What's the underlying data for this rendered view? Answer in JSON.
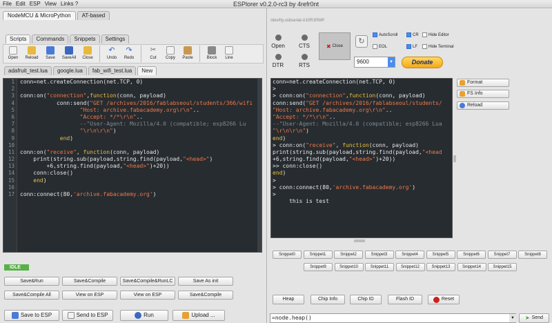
{
  "window": {
    "title": "ESPlorer v0.2.0-rc3 by 4refr0nt"
  },
  "menu": [
    "File",
    "Edit",
    "ESP",
    "View",
    "Links ?"
  ],
  "firmware_tabs": [
    "NodeMCU & MicroPython",
    "AT-based"
  ],
  "sub_tabs": [
    "Scripts",
    "Commands",
    "Snippets",
    "Settings"
  ],
  "toolbar": {
    "open": "Open",
    "reload": "Reload",
    "save": "Save",
    "saveall": "SaveAll",
    "close": "Close",
    "undo": "Undo",
    "redo": "Redo",
    "cut": "Cut",
    "copy": "Copy",
    "paste": "Paste",
    "block": "Block",
    "line": "Line"
  },
  "file_tabs": [
    "adafruit_test.lua",
    "google.lua",
    "fab_wifi_test.lua",
    "New"
  ],
  "editor": {
    "line_numbers": [
      "1",
      "2",
      "3",
      "4",
      "5",
      "6",
      "7",
      "8",
      "9",
      "10",
      "11",
      "12",
      "13",
      "14",
      "15",
      "16",
      "17"
    ]
  },
  "status": {
    "idle": "IDLE"
  },
  "left_buttons": {
    "save_run": "Save&Run",
    "save_compile": "Save&Compile",
    "save_compile_runlc": "Save&Compile&RunLC",
    "save_as_init": "Save As init",
    "save_compile_all": "Save&Compile All",
    "view_on_esp_1": "View on ESP",
    "view_on_esp_2": "View on ESP",
    "save_compile_2": "Save&Compile",
    "save_to_esp": "Save to ESP",
    "send_to_esp": "Send to ESP",
    "run": "Run",
    "upload": "Upload ..."
  },
  "connection": {
    "port": "/dev/tty.usbserial-A10R1RMP",
    "open": "Open",
    "cts": "CTS",
    "dtr": "DTR",
    "rts": "RTS",
    "close": "Close",
    "autoscroll": "AutoScroll",
    "eol": "EOL",
    "cr": "CR",
    "lf": "LF",
    "hide_editor": "Hide Editor",
    "hide_terminal": "Hide Terminal",
    "baud": "9600",
    "donate": "Donate"
  },
  "side_buttons": {
    "format": "Format",
    "fs_info": "FS Info",
    "reload": "Reload"
  },
  "snippets": [
    "Snippet0",
    "Snippet1",
    "Snippet2",
    "Snippet3",
    "Snippet4",
    "Snippet5",
    "Snippet6",
    "Snippet7",
    "Snippet8",
    "Snippet9",
    "Snippet10",
    "Snippet11",
    "Snippet12",
    "Snippet13",
    "Snippet14",
    "Snippet15"
  ],
  "bottom_buttons": {
    "heap": "Heap",
    "chip_info": "Chip Info",
    "chip_id": "Chip ID",
    "flash_id": "Flash ID",
    "reset": "Reset"
  },
  "command": {
    "value": "=node.heap()",
    "send": "Send"
  },
  "colors": {
    "editor_bg": "#272c30",
    "string": "#f07848",
    "keyword": "#e8c040",
    "comment": "#7f8a90",
    "idle": "#58b048",
    "donate": "#f4a818"
  }
}
